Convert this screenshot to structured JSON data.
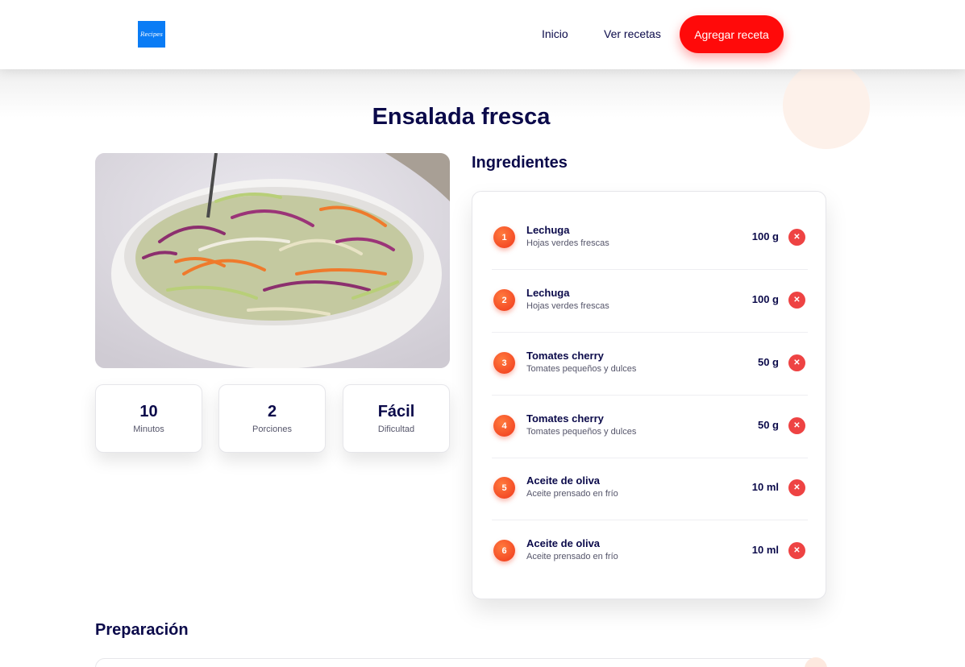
{
  "header": {
    "logo_text": "Recipes",
    "nav": {
      "home": "Inicio",
      "recipes": "Ver recetas",
      "add": "Agregar receta"
    }
  },
  "recipe": {
    "title": "Ensalada fresca",
    "stats": [
      {
        "value": "10",
        "label": "Minutos"
      },
      {
        "value": "2",
        "label": "Porciones"
      },
      {
        "value": "Fácil",
        "label": "Dificultad"
      }
    ]
  },
  "ingredients": {
    "heading": "Ingredientes",
    "items": [
      {
        "num": "1",
        "name": "Lechuga",
        "desc": "Hojas verdes frescas",
        "qty": "100 g"
      },
      {
        "num": "2",
        "name": "Lechuga",
        "desc": "Hojas verdes frescas",
        "qty": "100 g"
      },
      {
        "num": "3",
        "name": "Tomates cherry",
        "desc": "Tomates pequeños y dulces",
        "qty": "50 g"
      },
      {
        "num": "4",
        "name": "Tomates cherry",
        "desc": "Tomates pequeños y dulces",
        "qty": "50 g"
      },
      {
        "num": "5",
        "name": "Aceite de oliva",
        "desc": "Aceite prensado en frío",
        "qty": "10 ml"
      },
      {
        "num": "6",
        "name": "Aceite de oliva",
        "desc": "Aceite prensado en frío",
        "qty": "10 ml"
      }
    ],
    "delete_icon": "close-icon"
  },
  "preparation": {
    "heading": "Preparación"
  },
  "colors": {
    "accent": "#ff0a0a",
    "navy": "#0b0a4a",
    "logo_bg": "#0a7cf5",
    "badge": "#f0381c"
  }
}
